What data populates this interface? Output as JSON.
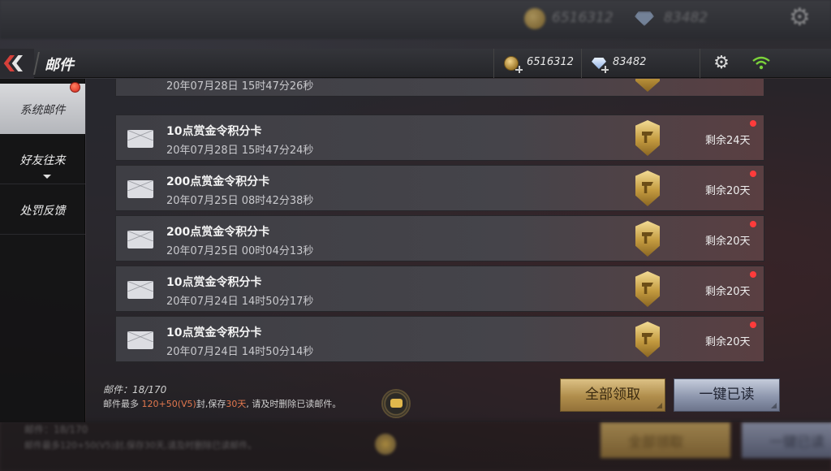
{
  "background": {
    "coins": "6516312",
    "diamonds": "83482",
    "mail_count": "邮件：18/170",
    "note": "邮件最多120+50(V5)封,保存30天,请及时删除已读邮件。",
    "collect_all_label": "全部领取",
    "read_all_label": "一键已读"
  },
  "header": {
    "title": "邮件",
    "coins": "6516312",
    "diamonds": "83482",
    "icons": {
      "back": "back-chevron-icon",
      "settings": "gear-icon",
      "wifi": "wifi-icon",
      "coin": "coin-icon",
      "diamond": "diamond-icon"
    }
  },
  "sidebar": {
    "items": [
      {
        "label": "系统邮件",
        "active": true,
        "has_badge": true
      },
      {
        "label": "好友往来",
        "active": false
      },
      {
        "label": "处罚反馈",
        "active": false
      }
    ]
  },
  "mails": [
    {
      "title": "",
      "date": "20年07月28日 15时47分26秒",
      "remain": ""
    },
    {
      "title": "10点赏金令积分卡",
      "date": "20年07月28日 15时47分24秒",
      "remain": "剩余24天"
    },
    {
      "title": "200点赏金令积分卡",
      "date": "20年07月25日 08时42分38秒",
      "remain": "剩余20天"
    },
    {
      "title": "200点赏金令积分卡",
      "date": "20年07月25日 00时04分13秒",
      "remain": "剩余20天"
    },
    {
      "title": "10点赏金令积分卡",
      "date": "20年07月24日 14时50分17秒",
      "remain": "剩余20天"
    },
    {
      "title": "10点赏金令积分卡",
      "date": "20年07月24日 14时50分14秒",
      "remain": "剩余20天"
    }
  ],
  "footer": {
    "count_label": "邮件：",
    "count_value": "18/170",
    "note_prefix": "邮件最多 ",
    "note_limit": "120+50(V5)",
    "note_mid": "封,保存",
    "note_days": "30天",
    "note_suffix": ", 请及时删除已读邮件。",
    "collect_all_label": "全部领取",
    "read_all_label": "一键已读"
  },
  "colors": {
    "accent_red": "#d6403a",
    "unread": "#ff3b3b",
    "highlight": "#e3784e",
    "gold": "#c39a3f"
  }
}
